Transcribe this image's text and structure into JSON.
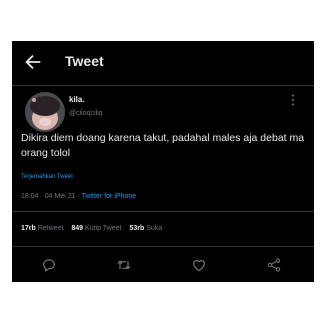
{
  "header": {
    "title": "Tweet"
  },
  "author": {
    "name": "kila.",
    "handle": "@ciloqciliq"
  },
  "tweet": {
    "text": "Dikira diem doang karena takut, padahal males aja debat ma orang tolol",
    "translate_label": "Terjemahkan Tweet",
    "time": "18:04",
    "separator": "·",
    "date": "04 Mei 21",
    "source": "Twitter for iPhone"
  },
  "stats": {
    "retweets_count": "17rb",
    "retweets_label": "Retweet",
    "quotes_count": "849",
    "quotes_label": "Kutip Tweet",
    "likes_count": "53rb",
    "likes_label": "Suka"
  },
  "icons": {
    "back": "back-arrow-icon",
    "more": "more-vertical-icon",
    "reply": "reply-icon",
    "retweet": "retweet-icon",
    "like": "heart-icon",
    "share": "share-icon"
  },
  "colors": {
    "background": "#000000",
    "text": "#e7e9ea",
    "muted": "#71767b",
    "accent": "#1d9bf0",
    "divider": "#2f3336"
  }
}
